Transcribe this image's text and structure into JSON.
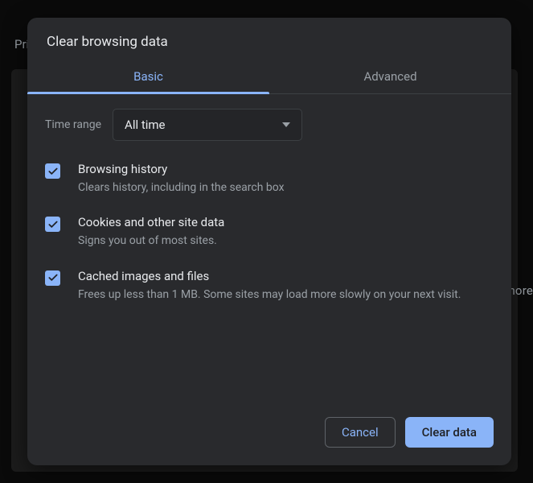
{
  "background": {
    "left_text": "Priv",
    "right_text": "nore"
  },
  "dialog": {
    "title": "Clear browsing data",
    "tabs": {
      "basic": "Basic",
      "advanced": "Advanced"
    },
    "time_range": {
      "label": "Time range",
      "value": "All time"
    },
    "options": [
      {
        "checked": true,
        "title": "Browsing history",
        "desc": "Clears history, including in the search box"
      },
      {
        "checked": true,
        "title": "Cookies and other site data",
        "desc": "Signs you out of most sites."
      },
      {
        "checked": true,
        "title": "Cached images and files",
        "desc": "Frees up less than 1 MB. Some sites may load more slowly on your next visit."
      }
    ],
    "buttons": {
      "cancel": "Cancel",
      "clear": "Clear data"
    }
  }
}
